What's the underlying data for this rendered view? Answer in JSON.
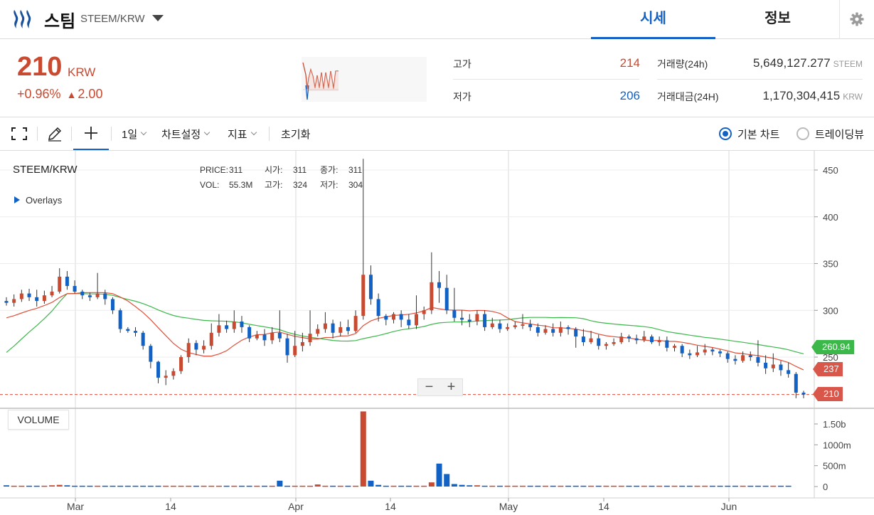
{
  "header": {
    "coin_name": "스팀",
    "pair": "STEEM/KRW",
    "tabs": [
      {
        "label": "시세"
      },
      {
        "label": "정보"
      }
    ]
  },
  "summary": {
    "price": "210",
    "price_unit": "KRW",
    "change_pct": "+0.96%",
    "change_arrow": "▲",
    "change_amount": "2.00",
    "high_label": "고가",
    "high_value": "214",
    "low_label": "저가",
    "low_value": "206",
    "volume_label": "거래량(24h)",
    "volume_value": "5,649,127.277",
    "volume_unit": "STEEM",
    "amount_label": "거래대금(24H)",
    "amount_value": "1,170,304,415",
    "amount_unit": "KRW"
  },
  "toolbar": {
    "interval": "1일",
    "chart_settings": "차트설정",
    "indicators": "지표",
    "reset": "초기화",
    "view_basic": "기본 차트",
    "view_trading": "트레이딩뷰"
  },
  "chart": {
    "pair_label": "STEEM/KRW",
    "overlays_label": "Overlays",
    "ohlc": {
      "price_label": "PRICE:",
      "price": "311",
      "vol_label": "VOL:",
      "vol": "55.3M",
      "open_label": "시가:",
      "open": "311",
      "high_label": "고가:",
      "high": "324",
      "close_label": "종가:",
      "close": "311",
      "low_label": "저가:",
      "low": "304"
    },
    "volume_label": "VOLUME",
    "zoom_out": "−",
    "zoom_in": "+",
    "tags": {
      "ma_long": "260.94",
      "ma_short": "237",
      "last": "210"
    },
    "colors": {
      "up": "#c84a31",
      "down": "#1261c4",
      "ma_short": "#e0503a",
      "ma_long": "#3cb84a"
    }
  },
  "chart_data": {
    "type": "candlestick",
    "price_ticks": [
      250,
      300,
      350,
      400,
      450
    ],
    "price_range": [
      200,
      462
    ],
    "volume_ticks": [
      "0",
      "500m",
      "1000m",
      "1.50b"
    ],
    "volume_range": [
      0,
      1.8
    ],
    "x_labels": [
      "Mar",
      "14",
      "Apr",
      "14",
      "May",
      "14",
      "Jun"
    ],
    "candles": [
      [
        310,
        308,
        314,
        305
      ],
      [
        308,
        312,
        317,
        304
      ],
      [
        312,
        318,
        322,
        309
      ],
      [
        318,
        314,
        323,
        310
      ],
      [
        314,
        310,
        322,
        304
      ],
      [
        310,
        316,
        321,
        307
      ],
      [
        316,
        320,
        326,
        314
      ],
      [
        320,
        336,
        345,
        318
      ],
      [
        336,
        326,
        342,
        322
      ],
      [
        326,
        320,
        332,
        318
      ],
      [
        320,
        316,
        322,
        312
      ],
      [
        316,
        314,
        319,
        310
      ],
      [
        314,
        318,
        340,
        312
      ],
      [
        318,
        312,
        322,
        306
      ],
      [
        312,
        300,
        314,
        296
      ],
      [
        300,
        280,
        302,
        276
      ],
      [
        280,
        278,
        282,
        276
      ],
      [
        278,
        276,
        282,
        272
      ],
      [
        276,
        262,
        278,
        258
      ],
      [
        262,
        245,
        264,
        238
      ],
      [
        245,
        228,
        246,
        222
      ],
      [
        228,
        230,
        236,
        220
      ],
      [
        230,
        235,
        238,
        226
      ],
      [
        235,
        250,
        252,
        232
      ],
      [
        250,
        265,
        270,
        244
      ],
      [
        265,
        258,
        268,
        252
      ],
      [
        258,
        262,
        268,
        254
      ],
      [
        262,
        276,
        286,
        258
      ],
      [
        276,
        284,
        296,
        272
      ],
      [
        284,
        280,
        289,
        276
      ],
      [
        280,
        288,
        300,
        276
      ],
      [
        288,
        282,
        294,
        276
      ],
      [
        282,
        270,
        284,
        266
      ],
      [
        270,
        274,
        278,
        268
      ],
      [
        274,
        268,
        280,
        262
      ],
      [
        268,
        276,
        282,
        264
      ],
      [
        276,
        270,
        300,
        266
      ],
      [
        270,
        252,
        275,
        244
      ],
      [
        252,
        262,
        278,
        250
      ],
      [
        262,
        266,
        276,
        256
      ],
      [
        266,
        275,
        300,
        262
      ],
      [
        275,
        280,
        285,
        272
      ],
      [
        280,
        286,
        298,
        276
      ],
      [
        286,
        276,
        290,
        270
      ],
      [
        276,
        282,
        288,
        272
      ],
      [
        282,
        278,
        290,
        274
      ],
      [
        278,
        294,
        300,
        276
      ],
      [
        294,
        338,
        462,
        290
      ],
      [
        338,
        312,
        348,
        306
      ],
      [
        312,
        294,
        318,
        288
      ],
      [
        294,
        290,
        296,
        284
      ],
      [
        290,
        296,
        298,
        286
      ],
      [
        296,
        290,
        300,
        282
      ],
      [
        290,
        284,
        296,
        280
      ],
      [
        284,
        296,
        316,
        280
      ],
      [
        296,
        300,
        304,
        290
      ],
      [
        300,
        330,
        362,
        296
      ],
      [
        330,
        324,
        342,
        308
      ],
      [
        324,
        300,
        338,
        296
      ],
      [
        300,
        292,
        324,
        288
      ],
      [
        292,
        290,
        300,
        284
      ],
      [
        290,
        288,
        296,
        282
      ],
      [
        288,
        296,
        300,
        284
      ],
      [
        296,
        282,
        300,
        278
      ],
      [
        282,
        286,
        292,
        280
      ],
      [
        286,
        280,
        290,
        276
      ],
      [
        280,
        282,
        286,
        278
      ],
      [
        282,
        284,
        288,
        280
      ],
      [
        284,
        285,
        296,
        280
      ],
      [
        285,
        282,
        290,
        278
      ],
      [
        282,
        276,
        286,
        272
      ],
      [
        276,
        280,
        284,
        274
      ],
      [
        280,
        276,
        286,
        272
      ],
      [
        276,
        282,
        288,
        272
      ],
      [
        282,
        280,
        284,
        274
      ],
      [
        280,
        272,
        282,
        260
      ],
      [
        272,
        266,
        280,
        262
      ],
      [
        266,
        270,
        278,
        264
      ],
      [
        270,
        262,
        274,
        258
      ],
      [
        262,
        264,
        266,
        258
      ],
      [
        264,
        266,
        270,
        262
      ],
      [
        266,
        272,
        276,
        264
      ],
      [
        272,
        270,
        274,
        266
      ],
      [
        270,
        268,
        274,
        264
      ],
      [
        268,
        272,
        278,
        266
      ],
      [
        272,
        266,
        274,
        264
      ],
      [
        266,
        268,
        272,
        262
      ],
      [
        268,
        260,
        272,
        256
      ],
      [
        260,
        262,
        264,
        256
      ],
      [
        262,
        254,
        264,
        250
      ],
      [
        254,
        252,
        258,
        248
      ],
      [
        252,
        255,
        262,
        250
      ],
      [
        255,
        258,
        264,
        252
      ],
      [
        258,
        256,
        260,
        252
      ],
      [
        256,
        254,
        258,
        250
      ],
      [
        254,
        248,
        256,
        244
      ],
      [
        248,
        246,
        252,
        242
      ],
      [
        246,
        252,
        256,
        244
      ],
      [
        252,
        250,
        256,
        246
      ],
      [
        250,
        244,
        268,
        240
      ],
      [
        244,
        238,
        252,
        232
      ],
      [
        238,
        242,
        254,
        234
      ],
      [
        242,
        236,
        246,
        230
      ],
      [
        236,
        232,
        244,
        228
      ],
      [
        232,
        212,
        234,
        206
      ],
      [
        212,
        210,
        214,
        206
      ]
    ],
    "volumes": [
      0.03,
      0.02,
      0.02,
      0.02,
      0.02,
      0.02,
      0.03,
      0.04,
      0.03,
      0.02,
      0.02,
      0.02,
      0.02,
      0.02,
      0.02,
      0.02,
      0.02,
      0.02,
      0.02,
      0.02,
      0.02,
      0.02,
      0.02,
      0.02,
      0.02,
      0.02,
      0.02,
      0.02,
      0.02,
      0.02,
      0.02,
      0.02,
      0.02,
      0.02,
      0.02,
      0.02,
      0.14,
      0.02,
      0.02,
      0.02,
      0.02,
      0.05,
      0.02,
      0.02,
      0.02,
      0.02,
      0.02,
      1.8,
      0.14,
      0.04,
      0.02,
      0.02,
      0.02,
      0.02,
      0.02,
      0.02,
      0.1,
      0.55,
      0.3,
      0.06,
      0.04,
      0.03,
      0.03,
      0.02,
      0.02,
      0.02,
      0.02,
      0.02,
      0.02,
      0.02,
      0.02,
      0.02,
      0.02,
      0.02,
      0.02,
      0.02,
      0.02,
      0.02,
      0.02,
      0.02,
      0.02,
      0.02,
      0.02,
      0.02,
      0.02,
      0.02,
      0.02,
      0.02,
      0.02,
      0.02,
      0.02,
      0.02,
      0.02,
      0.02,
      0.02,
      0.02,
      0.02,
      0.02,
      0.02,
      0.02,
      0.02,
      0.02,
      0.02,
      0.02
    ],
    "ma_short_window": 10,
    "ma_long_window": 30
  }
}
